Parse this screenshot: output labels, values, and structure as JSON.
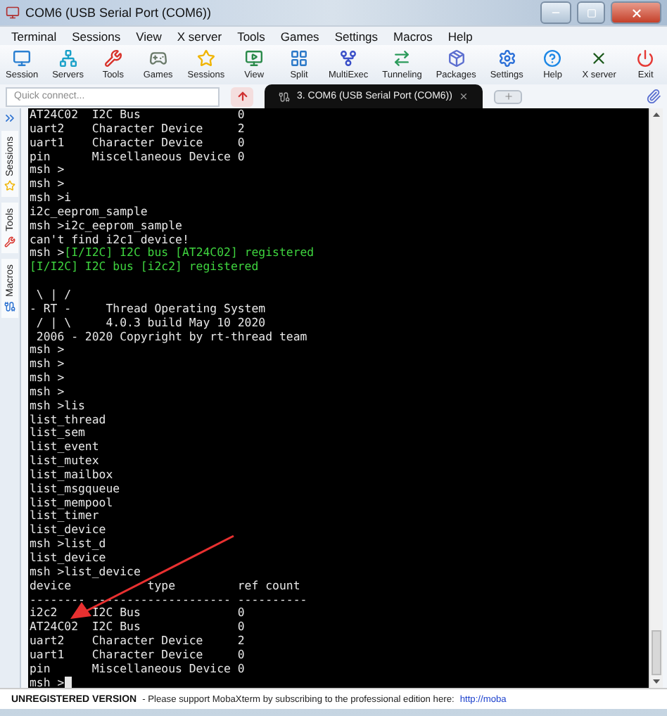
{
  "window": {
    "title": "COM6  (USB Serial Port (COM6))"
  },
  "menu": [
    "Terminal",
    "Sessions",
    "View",
    "X server",
    "Tools",
    "Games",
    "Settings",
    "Macros",
    "Help"
  ],
  "toolbar": [
    {
      "label": "Session",
      "kind": "session"
    },
    {
      "label": "Servers",
      "kind": "servers"
    },
    {
      "label": "Tools",
      "kind": "tools"
    },
    {
      "label": "Games",
      "kind": "games"
    },
    {
      "label": "Sessions",
      "kind": "star"
    },
    {
      "label": "View",
      "kind": "view"
    },
    {
      "label": "Split",
      "kind": "split"
    },
    {
      "label": "MultiExec",
      "kind": "multiexec"
    },
    {
      "label": "Tunneling",
      "kind": "tunneling"
    },
    {
      "label": "Packages",
      "kind": "packages"
    },
    {
      "label": "Settings",
      "kind": "settings"
    },
    {
      "label": "Help",
      "kind": "help"
    },
    {
      "label": "X server",
      "kind": "xserver"
    },
    {
      "label": "Exit",
      "kind": "exit"
    }
  ],
  "quick_connect": {
    "placeholder": "Quick connect..."
  },
  "tabs": [
    {
      "label": "3. COM6  (USB Serial Port (COM6))",
      "selected": true
    }
  ],
  "side_tabs": [
    {
      "label": "Sessions",
      "kind": "star"
    },
    {
      "label": "Tools",
      "kind": "tools"
    },
    {
      "label": "Macros",
      "kind": "macros"
    }
  ],
  "terminal": {
    "lines": [
      [
        {
          "text": "AT24C02  I2C Bus              0",
          "kind": "text"
        }
      ],
      [
        {
          "text": "uart2    Character Device     2",
          "kind": "text"
        }
      ],
      [
        {
          "text": "uart1    Character Device     0",
          "kind": "text"
        }
      ],
      [
        {
          "text": "pin      Miscellaneous Device 0",
          "kind": "text"
        }
      ],
      [
        {
          "text": "msh >",
          "kind": "text"
        }
      ],
      [
        {
          "text": "msh >",
          "kind": "text"
        }
      ],
      [
        {
          "text": "msh >i",
          "kind": "text"
        }
      ],
      [
        {
          "text": "i2c_eeprom_sample",
          "kind": "text"
        }
      ],
      [
        {
          "text": "msh >i2c_eeprom_sample",
          "kind": "text"
        }
      ],
      [
        {
          "text": "can't find i2c1 device!",
          "kind": "text"
        }
      ],
      [
        {
          "text": "msh >",
          "kind": "text"
        },
        {
          "text": "[I/I2C] I2C bus [AT24C02] registered",
          "kind": "log"
        }
      ],
      [
        {
          "text": "[I/I2C] I2C bus [i2c2] registered",
          "kind": "log"
        }
      ],
      {
        "blank_before": true,
        "segments": [
          {
            "text": " \\ | /",
            "kind": "text"
          }
        ]
      },
      [
        {
          "text": "- RT -     Thread Operating System",
          "kind": "text"
        }
      ],
      [
        {
          "text": " / | \\     4.0.3 build May 10 2020",
          "kind": "text"
        }
      ],
      [
        {
          "text": " 2006 - 2020 Copyright by rt-thread team",
          "kind": "text"
        }
      ],
      [
        {
          "text": "msh >",
          "kind": "text"
        }
      ],
      [
        {
          "text": "msh >",
          "kind": "text"
        }
      ],
      [
        {
          "text": "msh >",
          "kind": "text"
        }
      ],
      [
        {
          "text": "msh >",
          "kind": "text"
        }
      ],
      [
        {
          "text": "msh >lis",
          "kind": "text"
        }
      ],
      [
        {
          "text": "list_thread",
          "kind": "text"
        }
      ],
      [
        {
          "text": "list_sem",
          "kind": "text"
        }
      ],
      [
        {
          "text": "list_event",
          "kind": "text"
        }
      ],
      [
        {
          "text": "list_mutex",
          "kind": "text"
        }
      ],
      [
        {
          "text": "list_mailbox",
          "kind": "text"
        }
      ],
      [
        {
          "text": "list_msgqueue",
          "kind": "text"
        }
      ],
      [
        {
          "text": "list_mempool",
          "kind": "text"
        }
      ],
      [
        {
          "text": "list_timer",
          "kind": "text"
        }
      ],
      [
        {
          "text": "list_device",
          "kind": "text"
        }
      ],
      [
        {
          "text": "msh >list_d",
          "kind": "text"
        }
      ],
      [
        {
          "text": "list_device",
          "kind": "text"
        }
      ],
      [
        {
          "text": "msh >list_device",
          "kind": "text"
        }
      ],
      [
        {
          "text": "device           type         ref count",
          "kind": "text"
        }
      ],
      [
        {
          "text": "-------- -------------------- ----------",
          "kind": "text"
        }
      ],
      [
        {
          "text": "i2c2     I2C Bus              0",
          "kind": "text"
        }
      ],
      [
        {
          "text": "AT24C02  I2C Bus              0",
          "kind": "text"
        }
      ],
      [
        {
          "text": "uart2    Character Device     2",
          "kind": "text"
        }
      ],
      [
        {
          "text": "uart1    Character Device     0",
          "kind": "text"
        }
      ],
      [
        {
          "text": "pin      Miscellaneous Device 0",
          "kind": "text"
        }
      ],
      [
        {
          "text": "msh >",
          "kind": "text"
        }
      ]
    ],
    "cursor": true
  },
  "status_bar": {
    "label": "UNREGISTERED VERSION",
    "message": "-  Please support MobaXterm by subscribing to the professional edition here:",
    "link": "http://moba"
  }
}
